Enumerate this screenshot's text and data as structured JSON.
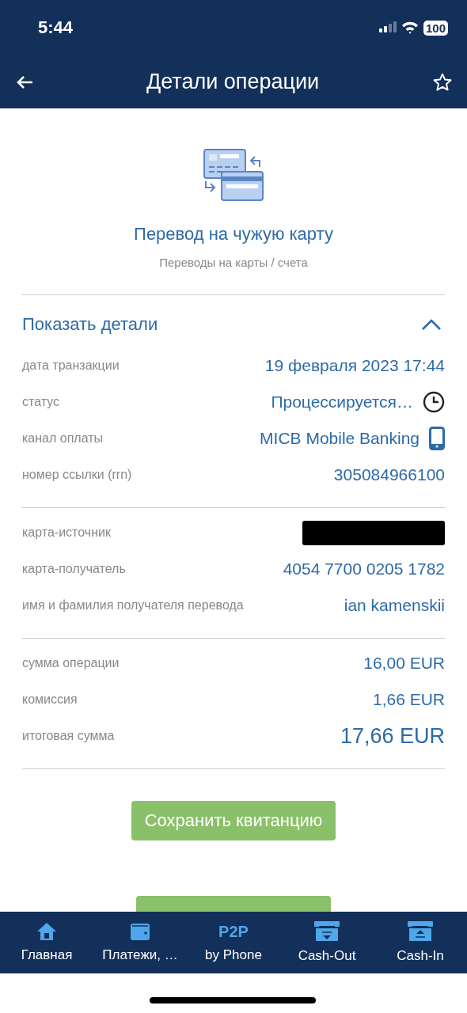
{
  "status_bar": {
    "time": "5:44",
    "battery": "100"
  },
  "nav": {
    "title": "Детали операции"
  },
  "operation": {
    "title": "Перевод на чужую карту",
    "category": "Переводы на карты / счета"
  },
  "details": {
    "toggle": "Показать детали",
    "expanded": true,
    "groups": [
      [
        {
          "kind": "text",
          "label": "дата транзакции",
          "value": "19 февраля 2023 17:44"
        },
        {
          "kind": "clock",
          "label": "статус",
          "value": "Процессируется…"
        },
        {
          "kind": "device",
          "label": "канал оплаты",
          "value": "MICB Mobile Banking"
        },
        {
          "kind": "text",
          "label": "номер ссылки (rrn)",
          "value": "305084966100"
        }
      ],
      [
        {
          "kind": "redacted",
          "label": "карта-источник"
        },
        {
          "kind": "text",
          "label": "карта-получатель",
          "value": "4054 7700 0205 1782"
        },
        {
          "kind": "text",
          "label": "имя и фамилия получателя перевода",
          "value": "ian kamenskii"
        }
      ],
      [
        {
          "kind": "text",
          "label": "сумма операции",
          "value": "16,00 EUR"
        },
        {
          "kind": "text",
          "label": "комиссия",
          "value": "1,66 EUR"
        },
        {
          "kind": "total",
          "label": "итоговая сумма",
          "value": "17,66 EUR"
        }
      ]
    ]
  },
  "save_button": "Сохранить квитанцию",
  "tab_bar": [
    {
      "kind": "home",
      "label": "Главная"
    },
    {
      "kind": "wallet",
      "label": "Платежи, …"
    },
    {
      "kind": "p2p",
      "badge": "P2P",
      "label": "by Phone"
    },
    {
      "kind": "cashout",
      "label": "Cash-Out"
    },
    {
      "kind": "cashin",
      "label": "Cash-In"
    }
  ]
}
